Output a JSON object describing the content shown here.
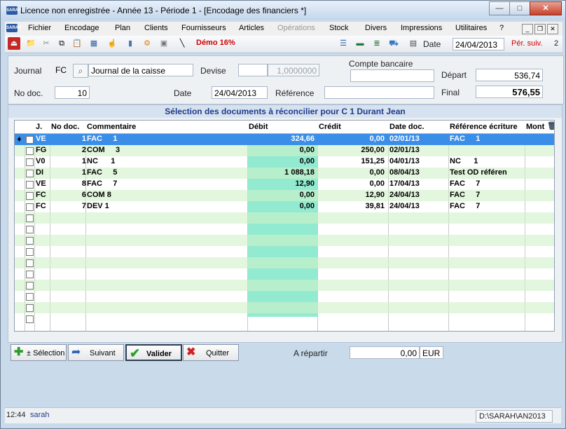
{
  "window": {
    "title": "Licence non enregistrée - Année 13 - Période 1 - [Encodage des financiers *]",
    "app_icon_text": "SARAH",
    "controls": {
      "minimize": "—",
      "maximize": "□",
      "close": "✕"
    }
  },
  "menubar": {
    "items": [
      "Fichier",
      "Encodage",
      "Plan",
      "Clients",
      "Fournisseurs",
      "Articles",
      "Opérations",
      "Stock",
      "Divers",
      "Impressions",
      "Utilitaires",
      "?"
    ],
    "mdi_controls": {
      "minimize": "_",
      "restore": "❐",
      "close": "✕"
    }
  },
  "toolbar": {
    "demo_label": "Démo 16%",
    "date_label": "Date",
    "date_value": "24/04/2013",
    "period_next_label": "Pér. suiv.",
    "period_next_value": "2"
  },
  "form": {
    "journal_label": "Journal",
    "journal_code": "FC",
    "journal_name": "Journal de la caisse",
    "devise_label": "Devise",
    "devise_value": "",
    "devise_rate": "1,0000000",
    "compte_bancaire_label": "Compte bancaire",
    "compte_bancaire_value": "",
    "depart_label": "Départ",
    "depart_value": "536,74",
    "no_doc_label": "No doc.",
    "no_doc_value": "10",
    "date_label": "Date",
    "date_value": "24/04/2013",
    "reference_label": "Référence",
    "reference_value": "",
    "final_label": "Final",
    "final_value": "576,55"
  },
  "grid": {
    "title": "Sélection des documents à réconcilier pour C 1 Durant Jean",
    "headers": {
      "journal": "J.",
      "no_doc": "No doc.",
      "commentaire": "Commentaire",
      "debit": "Débit",
      "credit": "Crédit",
      "date_doc": "Date doc.",
      "reference": "Référence écriture",
      "montant": "Mont"
    },
    "rows": [
      {
        "j": "VE",
        "no": "1",
        "comment": "FAC     1",
        "debit": "324,66",
        "credit": "0,00",
        "date": "02/01/13",
        "ref": "FAC     1"
      },
      {
        "j": "FG",
        "no": "2",
        "comment": "COM     3",
        "debit": "0,00",
        "credit": "250,00",
        "date": "02/01/13",
        "ref": ""
      },
      {
        "j": "V0",
        "no": "1",
        "comment": "NC      1",
        "debit": "0,00",
        "credit": "151,25",
        "date": "04/01/13",
        "ref": "NC      1"
      },
      {
        "j": "DI",
        "no": "1",
        "comment": "FAC     5",
        "debit": "1 088,18",
        "credit": "0,00",
        "date": "08/04/13",
        "ref": "Test OD référen"
      },
      {
        "j": "VE",
        "no": "8",
        "comment": "FAC     7",
        "debit": "12,90",
        "credit": "0,00",
        "date": "17/04/13",
        "ref": "FAC     7"
      },
      {
        "j": "FC",
        "no": "6",
        "comment": "COM 8",
        "debit": "0,00",
        "credit": "12,90",
        "date": "24/04/13",
        "ref": "FAC     7"
      },
      {
        "j": "FC",
        "no": "7",
        "comment": "DEV 1",
        "debit": "0,00",
        "credit": "39,81",
        "date": "24/04/13",
        "ref": "FAC     7"
      }
    ],
    "selected_row_index": 0
  },
  "actions": {
    "selection_label": "± Sélection",
    "suivant_label": "Suivant",
    "valider_label": "Valider",
    "quitter_label": "Quitter",
    "a_repartir_label": "A répartir",
    "a_repartir_value": "0,00",
    "a_repartir_currency": "EUR"
  },
  "statusbar": {
    "time": "12:44",
    "user": "sarah",
    "path": "D:\\SARAH\\AN2013"
  }
}
